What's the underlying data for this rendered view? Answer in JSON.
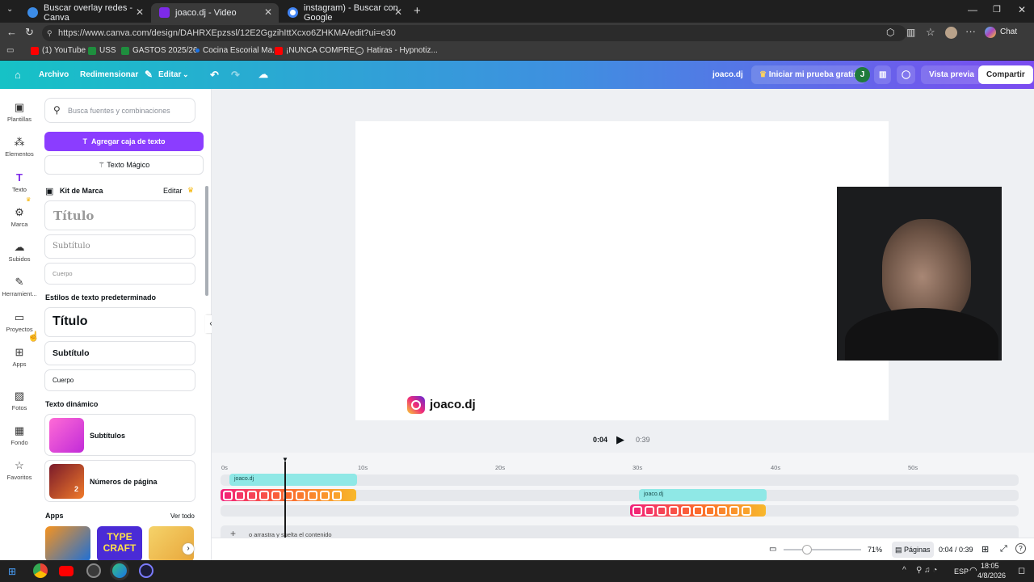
{
  "browser": {
    "tabs": [
      {
        "title": "Buscar overlay redes - Canva",
        "active": false,
        "color": "#3c8ce7"
      },
      {
        "title": "joaco.dj - Video",
        "active": true,
        "color": "#7d2ae8"
      },
      {
        "title": "instagram) - Buscar con Google",
        "active": false,
        "color": "#ffffff"
      }
    ],
    "url": "https://www.canva.com/design/DAHRXEpzssl/12E2GgzihIttXcxo6ZHKMA/edit?ui=e30",
    "ai_chat_label": "Chat",
    "bookmarks": [
      {
        "label": "(1) YouTube",
        "color": "#ff0000"
      },
      {
        "label": "USS",
        "color": "#1e8e3e"
      },
      {
        "label": "GASTOS 2025/26",
        "color": "#1e8e3e"
      },
      {
        "label": "Cocina Escorial Ma...",
        "color": "#1a73e8"
      },
      {
        "label": "¡NUNCA COMPRE...",
        "color": "#ff0000"
      },
      {
        "label": "Hatiras - Hypnotiz...",
        "color": "#c8c8c8"
      }
    ]
  },
  "header": {
    "archivo": "Archivo",
    "redimensionar": "Redimensionar",
    "editar": "Editar",
    "design_name": "joaco.dj",
    "trial": "Iniciar mi prueba gratis",
    "avatar_letter": "J",
    "preview": "Vista previa",
    "share": "Compartir"
  },
  "rail": [
    {
      "label": "Plantillas",
      "icon": "template-icon"
    },
    {
      "label": "Elementos",
      "icon": "shapes-icon"
    },
    {
      "label": "Texto",
      "icon": "text-icon",
      "active": true
    },
    {
      "label": "Marca",
      "icon": "brand-icon"
    },
    {
      "label": "Subidos",
      "icon": "cloud-upload-icon"
    },
    {
      "label": "Herramient...",
      "icon": "pen-tool-icon"
    },
    {
      "label": "Proyectos",
      "icon": "folder-icon"
    },
    {
      "label": "Apps",
      "icon": "apps-grid-icon"
    },
    {
      "label": "Fotos",
      "icon": "photo-icon"
    },
    {
      "label": "Fondo",
      "icon": "background-pattern-icon"
    },
    {
      "label": "Favoritos",
      "icon": "star-icon"
    }
  ],
  "panel": {
    "search_placeholder": "Busca fuentes y combinaciones",
    "add_text": "Agregar caja de texto",
    "magic_text": "Texto Mágico",
    "brand_kit": "Kit de Marca",
    "brand_edit": "Editar",
    "brand_styles": [
      "Título",
      "Subtítulo",
      "Cuerpo"
    ],
    "default_styles_title": "Estilos de texto predeterminado",
    "default_styles": [
      "Título",
      "Subtítulo",
      "Cuerpo"
    ],
    "dynamic_title": "Texto dinámico",
    "dynamic": [
      {
        "label": "Subtítulos"
      },
      {
        "label": "Números de página",
        "badge": "2"
      }
    ],
    "apps_title": "Apps",
    "apps_see_all": "Ver todo",
    "app_tile_text": "TYPE CRAFT"
  },
  "canvas": {
    "handle": "joaco.dj",
    "accent_gradient": [
      "#f9ce34",
      "#ee2a7b",
      "#6228d7"
    ]
  },
  "playback": {
    "current": "0:04",
    "total": "0:39"
  },
  "timeline": {
    "ticks": [
      "0s",
      "10s",
      "20s",
      "30s",
      "40s",
      "50s"
    ],
    "clip_label_1": "joaco.dj",
    "clip_label_2": "joaco.dj",
    "drop_hint": "o arrastra y suelta el contenido"
  },
  "bottombar": {
    "zoom": "71%",
    "pages": "Páginas",
    "time": "0:04 / 0:39",
    "zoom_level": 0.3
  },
  "taskbar": {
    "time": "18:05",
    "date": "4/8/2026",
    "lang": "ESP"
  }
}
